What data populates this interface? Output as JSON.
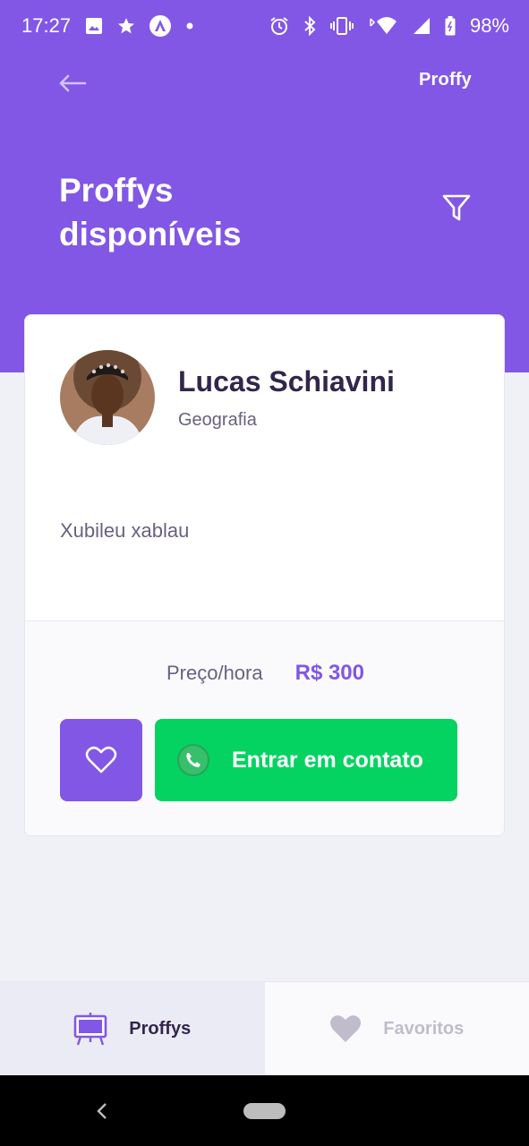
{
  "status_bar": {
    "time": "17:27",
    "battery": "98%",
    "icons": [
      "image-icon",
      "star-icon",
      "app-icon",
      "dot-icon",
      "alarm-icon",
      "bluetooth-icon",
      "vibrate-icon",
      "wifi-icon",
      "signal-icon",
      "battery-icon"
    ]
  },
  "header": {
    "brand": "Proffy",
    "title": "Proffys disponíveis",
    "back_icon": "arrow-left-icon",
    "filter_icon": "filter-icon"
  },
  "teacher_card": {
    "name": "Lucas Schiavini",
    "subject": "Geografia",
    "bio": "Xubileu xablau",
    "price_label": "Preço/hora",
    "price_value": "R$ 300",
    "favorite_icon": "heart-outline-icon",
    "contact_label": "Entrar em contato",
    "contact_icon": "whatsapp-icon"
  },
  "tabs": [
    {
      "label": "Proffys",
      "icon": "easel-icon",
      "active": true
    },
    {
      "label": "Favoritos",
      "icon": "heart-icon",
      "active": false
    }
  ],
  "colors": {
    "primary": "#8257e5",
    "whatsapp_green": "#04d361",
    "title_dark": "#32264d",
    "text_muted": "#6a6180",
    "background": "#f0f0f7"
  }
}
